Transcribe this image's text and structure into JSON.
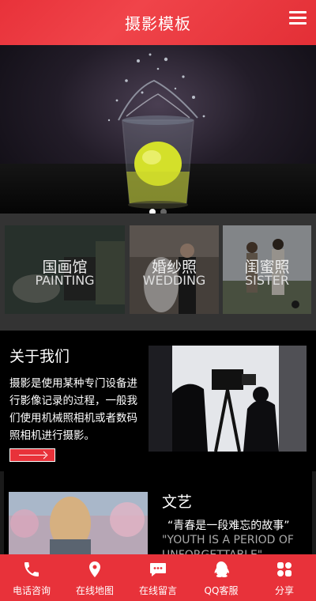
{
  "header": {
    "title": "摄影模板",
    "menu_icon": "hamburger-menu-icon"
  },
  "banner": {
    "slide_count": 2,
    "active_slide": 1
  },
  "categories": [
    {
      "cn": "国画馆",
      "en": "PAINTING"
    },
    {
      "cn": "婚纱照",
      "en": "WEDDING"
    },
    {
      "cn": "闺蜜照",
      "en": "SISTER"
    }
  ],
  "about": {
    "heading": "关于我们",
    "text": "摄影是使用某种专门设备进行影像记录的过程，一般我们使用机械照相机或者数码照相机进行摄影。",
    "more_icon": "arrow-right-icon"
  },
  "art": {
    "heading": "文艺",
    "quote": "“青春是一段难忘的故事”",
    "quote_en": "\"YOUTH IS A PERIOD OF UNFORGETTABLE\""
  },
  "footer": {
    "items": [
      {
        "label": "电话咨询",
        "icon": "phone-icon"
      },
      {
        "label": "在线地图",
        "icon": "map-pin-icon"
      },
      {
        "label": "在线留言",
        "icon": "message-icon"
      },
      {
        "label": "QQ客服",
        "icon": "qq-icon"
      },
      {
        "label": "分享",
        "icon": "share-icon"
      }
    ]
  },
  "colors": {
    "accent": "#e8323a",
    "category_band": "#333333"
  }
}
